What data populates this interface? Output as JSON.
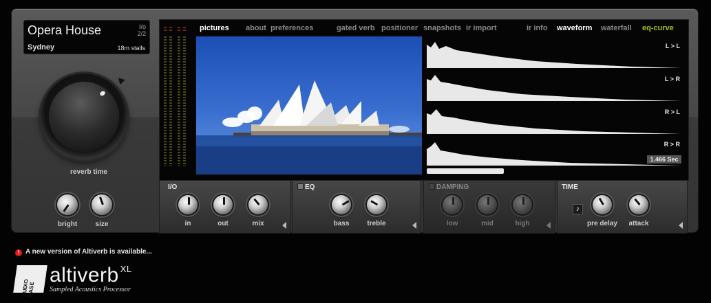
{
  "preset": {
    "name": "Opera House",
    "location": "Sydney",
    "io_label": "I/o",
    "io_value": "2/2",
    "position": "18m stalls"
  },
  "left": {
    "reverb_time_label": "reverb time",
    "bright_label": "bright",
    "size_label": "size"
  },
  "tabs": [
    {
      "label": "pictures",
      "state": "active"
    },
    {
      "label": "about"
    },
    {
      "label": "preferences"
    },
    {
      "label": "gated verb"
    },
    {
      "label": "positioner"
    },
    {
      "label": "snapshots"
    },
    {
      "label": "ir import"
    },
    {
      "label": "ir info"
    },
    {
      "label": "waveform",
      "state": "active"
    },
    {
      "label": "waterfall"
    },
    {
      "label": "eq-curve",
      "state": "highlight",
      "color": "#a3c21c"
    }
  ],
  "waveform": {
    "channels": [
      "L > L",
      "L > R",
      "R > L",
      "R > R"
    ],
    "length": "1.466 Sec"
  },
  "sections": {
    "io": {
      "title": "I/O",
      "knobs": [
        "in",
        "out",
        "mix"
      ]
    },
    "eq": {
      "title": "EQ",
      "knobs": [
        "bass",
        "treble"
      ]
    },
    "damping": {
      "title": "DAMPING",
      "knobs": [
        "low",
        "mid",
        "high"
      ]
    },
    "time": {
      "title": "TIME",
      "knobs": [
        "pre delay",
        "attack"
      ],
      "note_icon": "♪"
    }
  },
  "footer": {
    "update_alert": "!",
    "update_text": "A new version of Altiverb is available...",
    "logo_text": "AUDIO EASE",
    "brand": "altiverb",
    "brand_suffix": "XL",
    "tagline": "Sampled Acoustics Processor"
  },
  "colors": {
    "accent_green": "#a3c21c",
    "alert_red": "#e21b1b"
  }
}
